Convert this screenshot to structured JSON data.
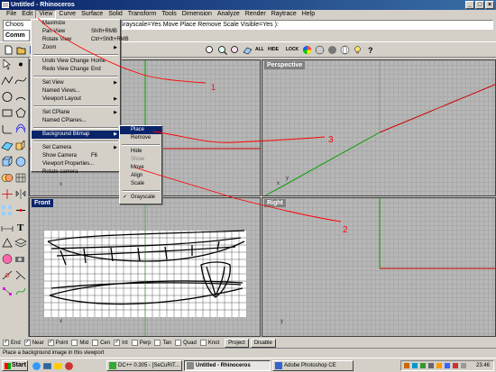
{
  "window": {
    "title": "Untitled - Rhinoceros"
  },
  "menubar": [
    "File",
    "Edit",
    "View",
    "Curve",
    "Surface",
    "Solid",
    "Transform",
    "Tools",
    "Dimension",
    "Analyze",
    "Render",
    "Raytrace",
    "Help"
  ],
  "command": {
    "history_prefix": "Choos",
    "history_text": "gn Grayscale=Yes  Move  Place  Remove  Scale  Visible=Yes ):",
    "prompt_label": "Comm"
  },
  "view_menu": {
    "items": [
      {
        "label": "Maximize",
        "shortcut": ""
      },
      {
        "label": "Pan View",
        "shortcut": "Shift+RMB"
      },
      {
        "label": "Rotate View",
        "shortcut": "Ctrl+Shift+RMB"
      },
      {
        "label": "Zoom",
        "shortcut": ""
      },
      {
        "label": "Undo View Change",
        "shortcut": "Home"
      },
      {
        "label": "Redo View Change",
        "shortcut": "End"
      },
      {
        "label": "Set View",
        "shortcut": ""
      },
      {
        "label": "Named Views...",
        "shortcut": ""
      },
      {
        "label": "Viewport Layout",
        "shortcut": ""
      },
      {
        "label": "Set CPlane",
        "shortcut": ""
      },
      {
        "label": "Named CPlanes...",
        "shortcut": ""
      },
      {
        "label": "Background Bitmap",
        "shortcut": ""
      },
      {
        "label": "Set Camera",
        "shortcut": ""
      },
      {
        "label": "Show Camera",
        "shortcut": "F6"
      },
      {
        "label": "Viewport Properties...",
        "shortcut": ""
      },
      {
        "label": "Rotate camera",
        "shortcut": ""
      }
    ]
  },
  "bitmap_submenu": {
    "items": [
      "Place",
      "Remove",
      "Hide",
      "Show",
      "Move",
      "Align",
      "Scale",
      "Grayscale"
    ]
  },
  "viewports": {
    "perspective": "Perspective",
    "front": "Front",
    "right": "Right"
  },
  "annotations": [
    "1",
    "2",
    "3"
  ],
  "toolbar_labels": {
    "all": "ALL",
    "hide": "HIDE",
    "lock": "LOCK"
  },
  "osnap": {
    "items": [
      {
        "label": "End",
        "checked": true
      },
      {
        "label": "Near",
        "checked": true
      },
      {
        "label": "Point",
        "checked": true
      },
      {
        "label": "Mid",
        "checked": false
      },
      {
        "label": "Cen",
        "checked": false
      },
      {
        "label": "Int",
        "checked": true
      },
      {
        "label": "Perp",
        "checked": false
      },
      {
        "label": "Tan",
        "checked": false
      },
      {
        "label": "Quad",
        "checked": false
      },
      {
        "label": "Knot",
        "checked": false
      }
    ],
    "project": "Project",
    "disable": "Disable"
  },
  "status": "Place a background image in this viewport",
  "taskbar": {
    "start": "Start",
    "tasks": [
      "DC++ 0.305 - [SeCuRiT...",
      "Untitled - Rhinoceros",
      "Adobe Photoshop CE"
    ],
    "clock": "23:46"
  },
  "colors": {
    "title_active": "#0a246a",
    "axis_red": "#cc0000",
    "axis_green": "#00a000",
    "annotation_red": "#ff0000"
  }
}
